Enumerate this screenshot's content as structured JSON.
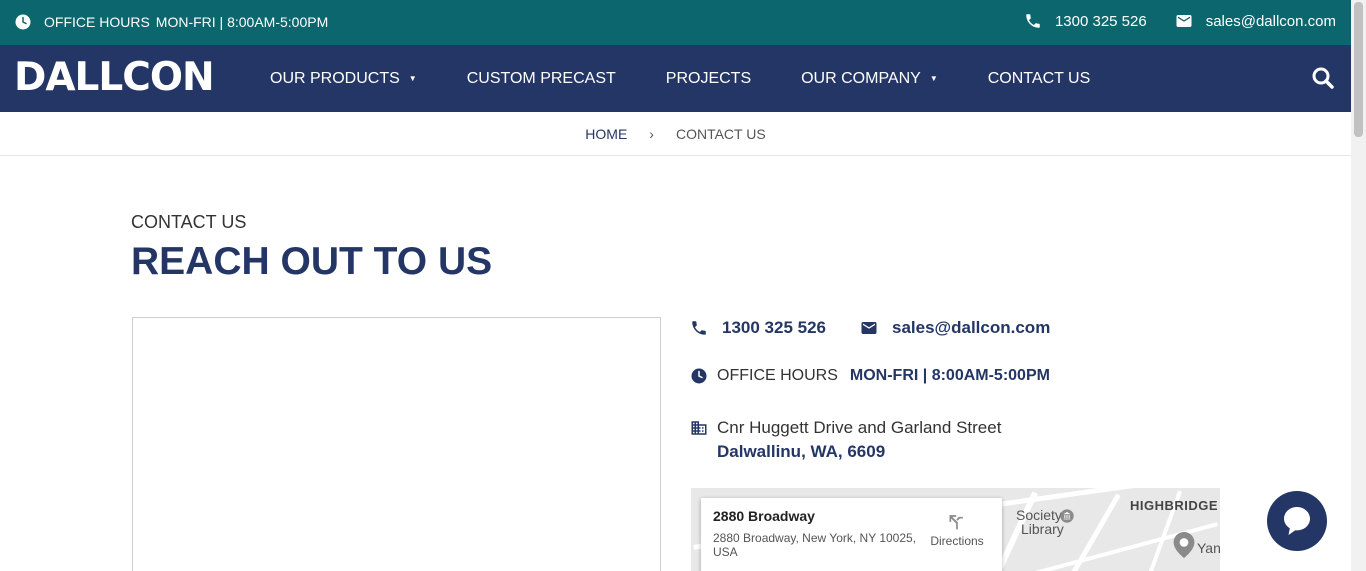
{
  "topbar": {
    "hours_label": "OFFICE HOURS",
    "hours_value": "MON-FRI | 8:00AM-5:00PM",
    "phone": "1300 325 526",
    "email": "sales@dallcon.com"
  },
  "navbar": {
    "logo": "DALLCON",
    "items": [
      {
        "label": "OUR PRODUCTS",
        "has_dropdown": true
      },
      {
        "label": "CUSTOM PRECAST",
        "has_dropdown": false
      },
      {
        "label": "PROJECTS",
        "has_dropdown": false
      },
      {
        "label": "OUR COMPANY",
        "has_dropdown": true
      },
      {
        "label": "CONTACT US",
        "has_dropdown": false
      }
    ]
  },
  "breadcrumb": {
    "home": "HOME",
    "separator": "›",
    "current": "CONTACT US"
  },
  "heading": {
    "eyebrow": "CONTACT US",
    "title": "REACH OUT TO US"
  },
  "contact": {
    "phone": "1300 325 526",
    "email": "sales@dallcon.com",
    "hours_label": "OFFICE HOURS",
    "hours_value": "MON-FRI | 8:00AM-5:00PM",
    "address_line1": "Cnr Huggett Drive and Garland Street",
    "address_line2": "Dalwallinu, WA, 6609"
  },
  "map": {
    "place_name": "2880 Broadway",
    "place_address": "2880 Broadway, New York, NY 10025, USA",
    "directions_label": "Directions",
    "area_label": "HIGHBRIDGE",
    "poi_label": "Yan",
    "society_label": "Society",
    "library_label": "Library"
  },
  "colors": {
    "topbar_bg": "#0b666e",
    "navbar_bg": "#243665",
    "accent": "#243665"
  }
}
